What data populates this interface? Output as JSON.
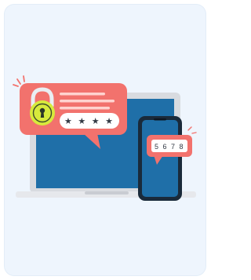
{
  "illustration": {
    "password_mask": "★ ★ ★ ★",
    "otp_code": "5 6 7 8",
    "icons": [
      "laptop-icon",
      "smartphone-icon",
      "padlock-icon",
      "password-speech-bubble",
      "otp-speech-bubble"
    ],
    "colors": {
      "card_background": "#eef5fd",
      "laptop_frame": "#d8dbe0",
      "laptop_screen": "#1f6fa8",
      "phone_body": "#1a2a3a",
      "phone_screen": "#1f6fa8",
      "bubble": "#f2726d",
      "lock_body": "#d7ea3c",
      "field_white": "#ffffff"
    }
  }
}
